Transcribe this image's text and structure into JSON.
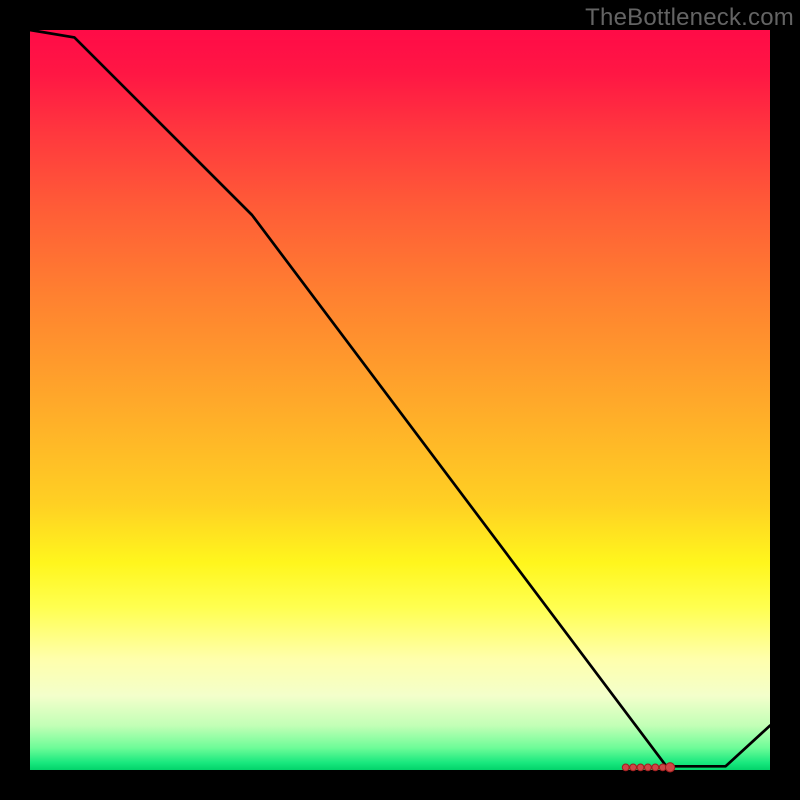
{
  "watermark": "TheBottleneck.com",
  "colors": {
    "page_bg": "#000000",
    "watermark": "#646464",
    "curve_stroke": "#000000",
    "marker_fill": "#cf4646",
    "marker_stroke": "#9f1f1f"
  },
  "chart_data": {
    "type": "line",
    "title": "",
    "xlabel": "",
    "ylabel": "",
    "xlim": [
      0,
      100
    ],
    "ylim": [
      0,
      100
    ],
    "grid": false,
    "series": [
      {
        "name": "curve",
        "x": [
          0,
          6,
          30,
          86,
          94,
          100
        ],
        "y": [
          100,
          99,
          75,
          0.5,
          0.5,
          6
        ]
      }
    ],
    "markers": {
      "cluster_x_range": [
        80.5,
        86.5
      ],
      "cluster_count": 7,
      "cluster_y": 0.35,
      "end_point": {
        "x": 86.5,
        "y": 0.35
      }
    },
    "background_gradient": {
      "direction": "vertical",
      "stops": [
        {
          "pos": 0,
          "color": "#ff0b47"
        },
        {
          "pos": 50,
          "color": "#ffa82a"
        },
        {
          "pos": 78,
          "color": "#ffff50"
        },
        {
          "pos": 94,
          "color": "#c2ffb6"
        },
        {
          "pos": 100,
          "color": "#02d36a"
        }
      ]
    }
  }
}
